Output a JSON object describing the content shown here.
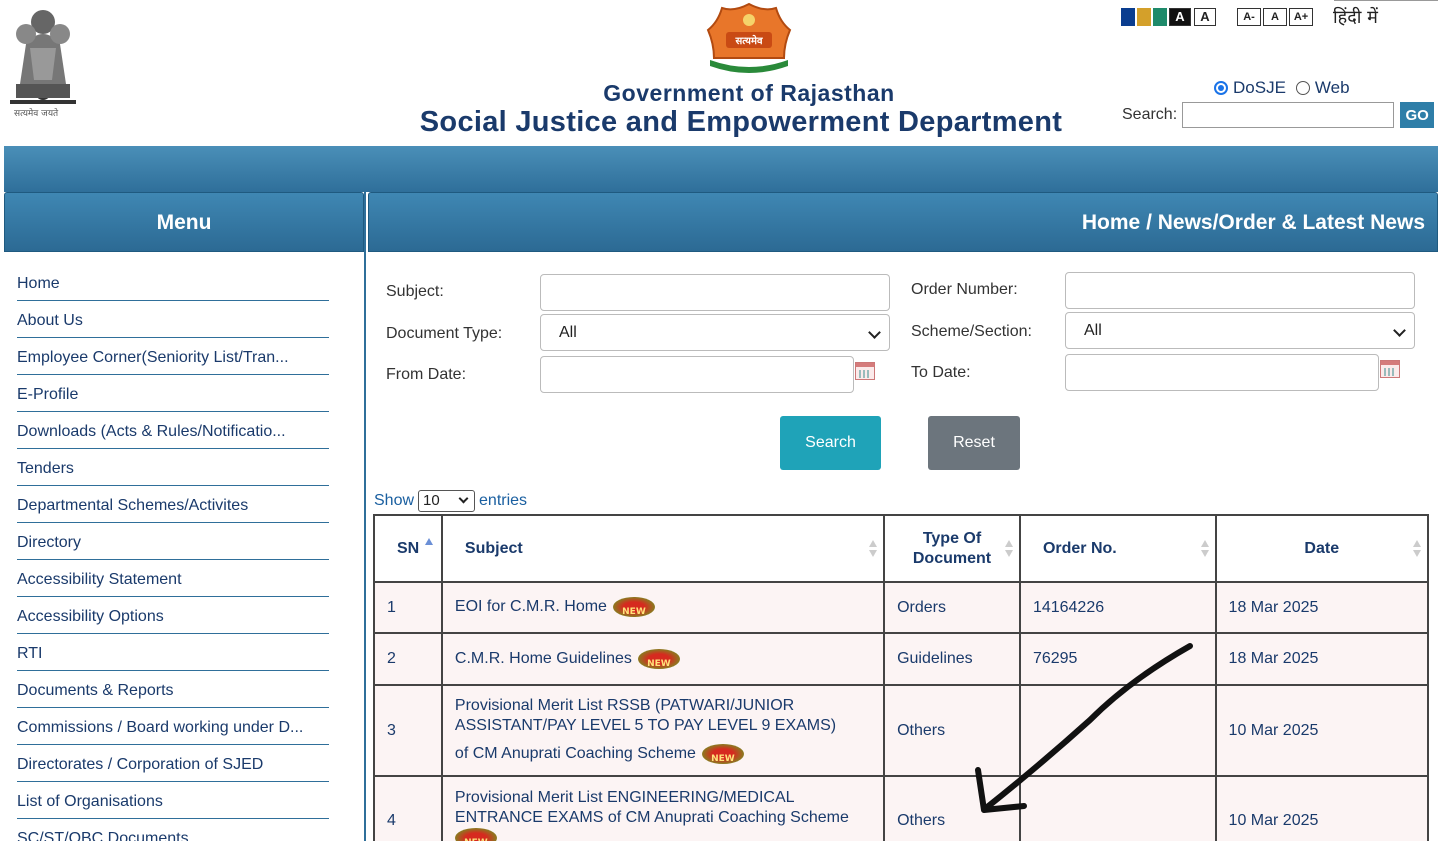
{
  "header": {
    "emblem_caption": "सत्यमेव जयते",
    "seal_text": "सत्यमेव जयते",
    "gov_title": "Government of Rajasthan",
    "dept_title": "Social Justice and Empowerment Department",
    "accessibility": {
      "color_swatches": [
        "#0a3d8f",
        "#d4a02a",
        "#1e8a6a"
      ],
      "contrast_dark": "A",
      "contrast_light": "A",
      "font_decrease": "A-",
      "font_normal": "A",
      "font_increase": "A+",
      "language": "हिंदी में"
    },
    "search_scope": [
      {
        "label": "DoSJE",
        "checked": true
      },
      {
        "label": "Web",
        "checked": false
      }
    ],
    "search_label": "Search:",
    "search_value": "",
    "go_label": "GO"
  },
  "menu": {
    "title": "Menu",
    "items": [
      "Home",
      "About Us",
      "Employee Corner(Seniority List/Tran...",
      "E-Profile",
      "Downloads (Acts & Rules/Notificatio...",
      "Tenders",
      "Departmental Schemes/Activites",
      "Directory",
      "Accessibility Statement",
      "Accessibility Options",
      "RTI",
      "Documents & Reports",
      "Commissions / Board working under D...",
      "Directorates / Corporation of SJED",
      "List of Organisations",
      "SC/ST/OBC Documents"
    ]
  },
  "main": {
    "breadcrumb": "Home / News/Order & Latest News",
    "form": {
      "subject_label": "Subject:",
      "subject_value": "",
      "order_number_label": "Order Number:",
      "order_number_value": "",
      "doc_type_label": "Document Type:",
      "doc_type_value": "All",
      "scheme_label": "Scheme/Section:",
      "scheme_value": "All",
      "from_date_label": "From Date:",
      "from_date_value": "",
      "to_date_label": "To Date:",
      "to_date_value": "",
      "search_button": "Search",
      "reset_button": "Reset"
    },
    "table": {
      "show_label": "Show",
      "entries_value": "10",
      "entries_label": "entries",
      "columns": [
        "SN",
        "Subject",
        "Type Of Document",
        "Order No.",
        "Date"
      ],
      "rows": [
        {
          "sn": "1",
          "subject": "EOI for C.M.R. Home",
          "type": "Orders",
          "order_no": "14164226",
          "date": "18 Mar 2025",
          "is_new": true
        },
        {
          "sn": "2",
          "subject": "C.M.R. Home Guidelines",
          "type": "Guidelines",
          "order_no": "76295",
          "date": "18 Mar 2025",
          "is_new": true
        },
        {
          "sn": "3",
          "subject_lines": [
            "Provisional Merit List RSSB (PATWARI/JUNIOR",
            "ASSISTANT/PAY LEVEL 5 TO PAY LEVEL 9 EXAMS)",
            "of CM Anuprati Coaching Scheme"
          ],
          "type": "Others",
          "order_no": "",
          "date": "10 Mar 2025",
          "is_new": true
        },
        {
          "sn": "4",
          "subject_lines": [
            "Provisional Merit List ENGINEERING/MEDICAL",
            "ENTRANCE EXAMS of CM Anuprati Coaching Scheme"
          ],
          "type": "Others",
          "order_no": "",
          "date": "10 Mar 2025",
          "is_new": true
        }
      ]
    }
  }
}
